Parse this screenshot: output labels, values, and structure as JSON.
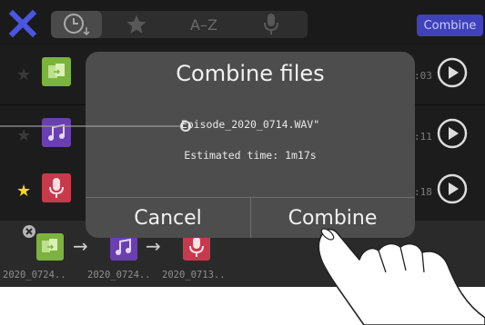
{
  "topbar": {
    "close_icon": "close-icon",
    "sort_buttons": [
      "clock-sort-icon",
      "star-sort-icon",
      "A–Z",
      "mic-sort-icon"
    ],
    "az_label": "A–Z",
    "combine_label": "Combine"
  },
  "rows": [
    {
      "starred": false,
      "thumb": "merge-file-icon",
      "time_fragment": ":03"
    },
    {
      "starred": false,
      "thumb": "music-file-icon",
      "time_fragment": ":11"
    },
    {
      "starred": true,
      "thumb": "mic-file-icon",
      "time_fragment": ":18"
    }
  ],
  "combine_strip": {
    "items": [
      {
        "icon": "merge-file-icon",
        "name": "2020_0724.."
      },
      {
        "icon": "music-file-icon",
        "name": "2020_0724.."
      },
      {
        "icon": "mic-file-icon",
        "name": "2020_0713.."
      }
    ],
    "arrow": "→"
  },
  "dialog": {
    "title": "Combine files",
    "filename": "Episode_2020_0714.WAV\"",
    "estimated": "Estimated time: 1m17s",
    "cancel_label": "Cancel",
    "combine_label": "Combine"
  },
  "colors": {
    "accent": "#3f42b8",
    "star_on": "#f2d81e",
    "merge_icon": "#7cb23e",
    "music_icon": "#6a3fb0",
    "mic_icon": "#c83a4b"
  }
}
